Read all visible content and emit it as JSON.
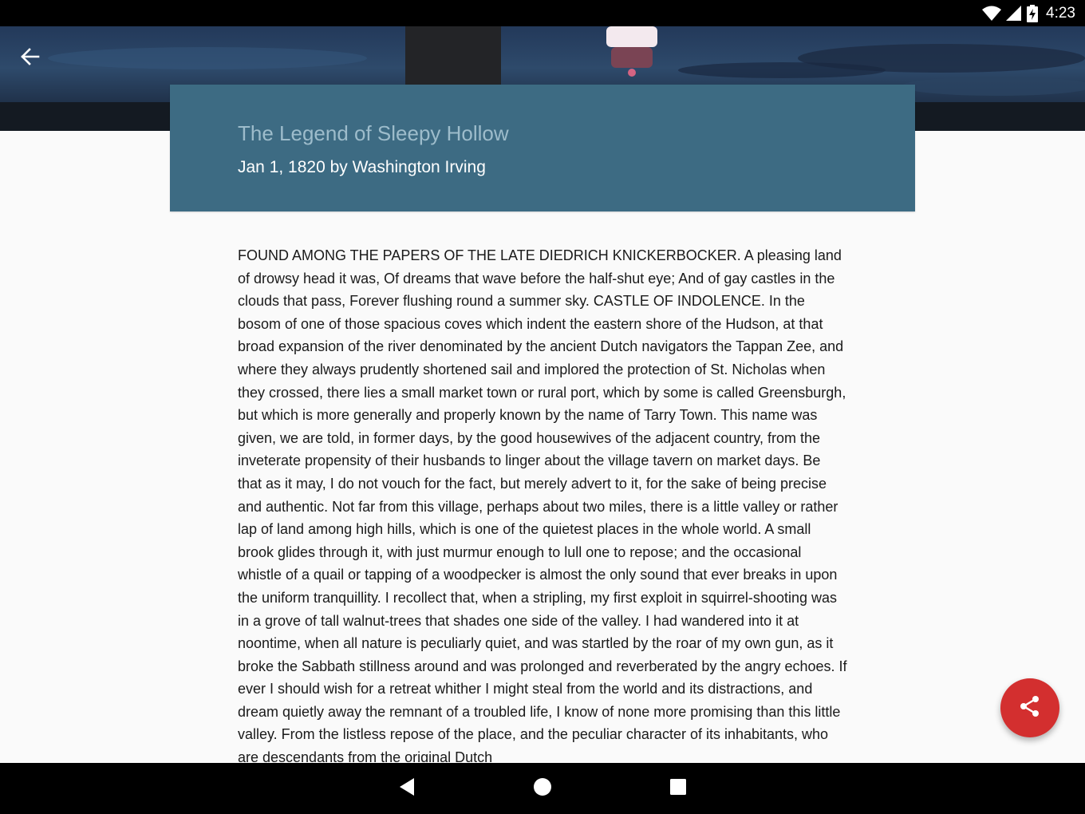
{
  "status_bar": {
    "time": "4:23",
    "icons": [
      "wifi-icon",
      "cell-signal-icon",
      "battery-charging-icon"
    ]
  },
  "toolbar": {
    "back_icon": "arrow-back-icon"
  },
  "article": {
    "title": "The Legend of Sleepy Hollow",
    "subtitle": "Jan 1, 1820 by Washington Irving",
    "body": "FOUND AMONG THE PAPERS OF THE LATE DIEDRICH KNICKERBOCKER. A pleasing land of drowsy head it was, Of dreams that wave before the half-shut eye; And of gay castles in the clouds that pass, Forever flushing round a summer sky. CASTLE OF INDOLENCE. In the bosom of one of those spacious coves which indent the eastern shore of the Hudson, at that broad expansion of the river denominated by the ancient Dutch navigators the Tappan Zee, and where they always prudently shortened sail and implored the protection of St. Nicholas when they crossed, there lies a small market town or rural port, which by some is called Greensburgh, but which is more generally and properly known by the name of Tarry Town. This name was given, we are told, in former days, by the good housewives of the adjacent country, from the inveterate propensity of their husbands to linger about the village tavern on market days. Be that as it may, I do not vouch for the fact, but merely advert to it, for the sake of being precise and authentic. Not far from this village, perhaps about two miles, there is a little valley or rather lap of land among high hills, which is one of the quietest places in the whole world. A small brook glides through it, with just murmur enough to lull one to repose; and the occasional whistle of a quail or tapping of a woodpecker is almost the only sound that ever breaks in upon the uniform tranquillity. I recollect that, when a stripling, my first exploit in squirrel-shooting was in a grove of tall walnut-trees that shades one side of the valley. I had wandered into it at noontime, when all nature is peculiarly quiet, and was startled by the roar of my own gun, as it broke the Sabbath stillness around and was prolonged and reverberated by the angry echoes. If ever I should wish for a retreat whither I might steal from the world and its distractions, and dream quietly away the remnant of a troubled life, I know of none more promising than this little valley. From the listless repose of the place, and the peculiar character of its inhabitants, who are descendants from the original Dutch"
  },
  "fab": {
    "icon": "share-icon",
    "color": "#d32f2f"
  },
  "nav_bar": {
    "icons": [
      "nav-back-icon",
      "nav-home-icon",
      "nav-recents-icon"
    ]
  },
  "colors": {
    "title_card": "#3d6b83",
    "title_text": "#9dbccb",
    "background": "#fafafa"
  }
}
